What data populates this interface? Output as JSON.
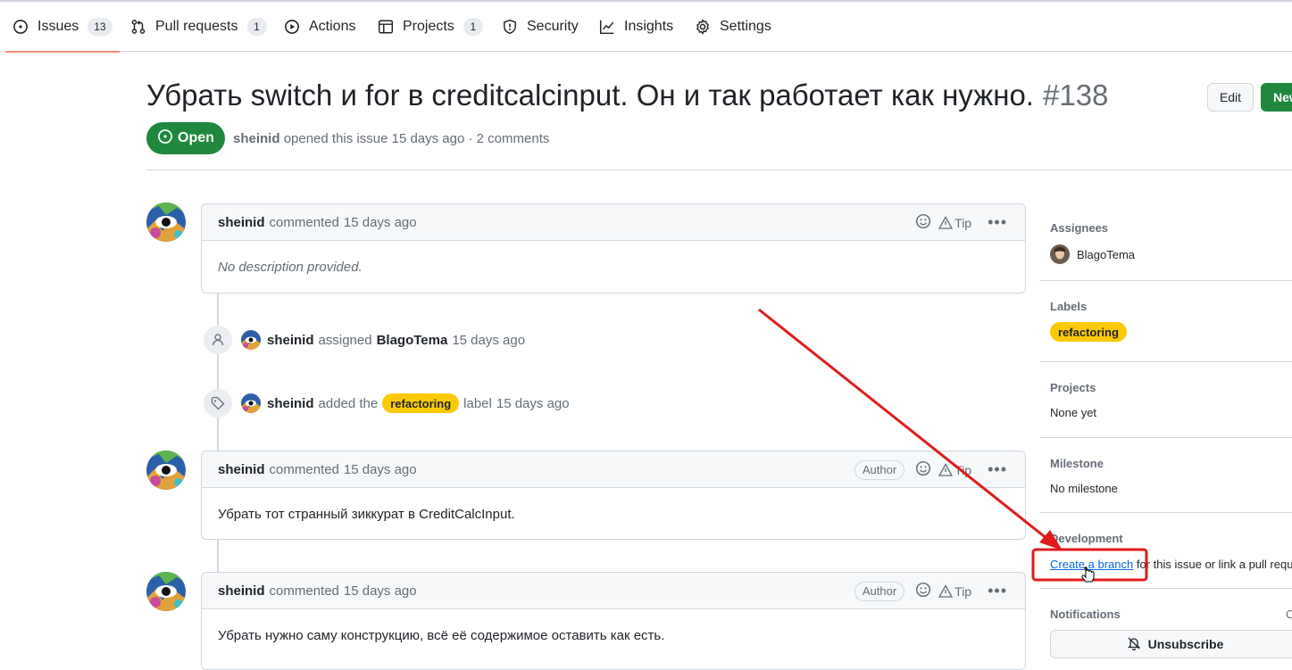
{
  "tabs": [
    {
      "label": "Issues",
      "count": "13"
    },
    {
      "label": "Pull requests",
      "count": "1"
    },
    {
      "label": "Actions"
    },
    {
      "label": "Projects",
      "count": "1"
    },
    {
      "label": "Security"
    },
    {
      "label": "Insights"
    },
    {
      "label": "Settings"
    }
  ],
  "issue": {
    "title": "Убрать switch и for в creditcalcinput. Он и так работает как нужно.",
    "number": "#138",
    "state": "Open",
    "author": "sheinid",
    "meta_rest": "opened this issue 15 days ago · 2 comments",
    "edit_label": "Edit",
    "new_label": "New"
  },
  "comments": [
    {
      "author": "sheinid",
      "action": "commented",
      "time": "15 days ago",
      "body": "No description provided.",
      "tip": "Tip"
    },
    {
      "author": "sheinid",
      "action": "commented",
      "time": "15 days ago",
      "badge": "Author",
      "body": "Убрать тот странный зиккурат в CreditCalcInput.",
      "tip": "Tip"
    },
    {
      "author": "sheinid",
      "action": "commented",
      "time": "15 days ago",
      "badge": "Author",
      "body": "Убрать нужно саму конструкцию, всё её содержимое оставить как есть.",
      "tip": "Tip"
    }
  ],
  "events": [
    {
      "actor": "sheinid",
      "verb": "assigned",
      "target": "BlagoTema",
      "time": "15 days ago"
    },
    {
      "actor": "sheinid",
      "verb": "added the",
      "label": "refactoring",
      "suffix": "label",
      "time": "15 days ago"
    }
  ],
  "sidebar": {
    "assignees_h": "Assignees",
    "assignee": "BlagoTema",
    "labels_h": "Labels",
    "label": "refactoring",
    "projects_h": "Projects",
    "projects_v": "None yet",
    "milestone_h": "Milestone",
    "milestone_v": "No milestone",
    "development_h": "Development",
    "create_branch": "Create a branch",
    "dev_rest": "for this issue or link a pull requ",
    "notifications_h": "Notifications",
    "notifications_extra": "C",
    "unsubscribe": "Unsubscribe"
  },
  "colors": {
    "accent_green": "#1f883d",
    "label_yellow": "#fbca04",
    "annotation_red": "#e01b1b",
    "link_blue": "#0969da"
  }
}
